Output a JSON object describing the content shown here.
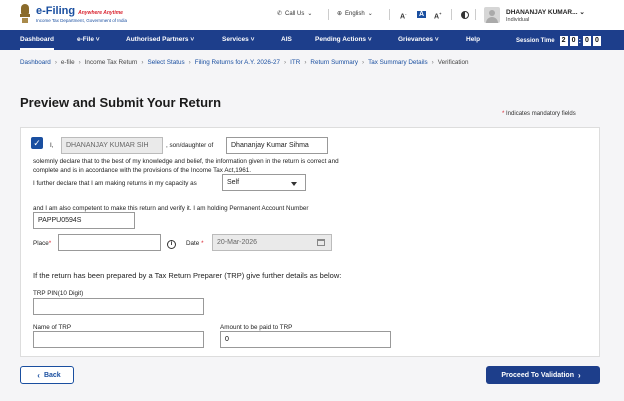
{
  "header": {
    "logo_title": "e-Filing",
    "logo_tagline": "Anywhere Anytime",
    "logo_subtitle": "Income Tax Department, Government of India",
    "call_us": "Call Us",
    "language": "English",
    "font_small": "A",
    "font_normal": "A",
    "font_large": "A",
    "user_name": "DHANANJAY KUMAR...",
    "user_role": "Individual"
  },
  "nav": {
    "items": [
      "Dashboard",
      "e-File",
      "Authorised Partners",
      "Services",
      "AIS",
      "Pending Actions",
      "Grievances",
      "Help"
    ],
    "session_label": "Session Time",
    "session_digits": [
      "2",
      "0",
      "0",
      "0"
    ]
  },
  "breadcrumb": [
    "Dashboard",
    "e-file",
    "Income Tax Return",
    "Select Status",
    "Filing Returns for A.Y. 2026-27",
    "ITR",
    "Return Summary",
    "Tax Summary Details",
    "Verification"
  ],
  "page_title": "Preview and Submit Your Return",
  "mandatory_note": "Indicates mandatory fields",
  "form": {
    "i_label": "I,",
    "name_value": "DHANANJAY KUMAR SIH",
    "son_of_label": ", son/daughter of",
    "father_value": "Dhananjay Kumar Sihma",
    "declaration_1": "solemnly declare that to the best of my knowledge and belief, the information given in the return is correct and",
    "declaration_2": "complete and is in accordance with the provisions of the Income Tax Act,1961.",
    "capacity_label": "I further declare that I am making returns in my capacity as",
    "capacity_value": "Self",
    "pan_label": "and I am also competent to make this return and verify it.  I am holding Permanent Account Number",
    "pan_value": "PAPPU0594S",
    "place_label": "Place",
    "place_value": "",
    "date_label": "Date",
    "date_value": "20-Mar-2026",
    "trp_heading": "If the return has been prepared by a Tax Return Preparer (TRP) give further details as below:",
    "trp_pin_label": "TRP PIN(10 Digit)",
    "trp_pin_value": "",
    "trp_name_label": "Name of TRP",
    "trp_name_value": "",
    "amount_label": "Amount to be paid to TRP",
    "amount_value": "0"
  },
  "buttons": {
    "back": "Back",
    "proceed": "Proceed To Validation"
  },
  "colors": {
    "primary": "#1d3e8b",
    "link": "#1a4fa0",
    "required": "#d9232f"
  }
}
